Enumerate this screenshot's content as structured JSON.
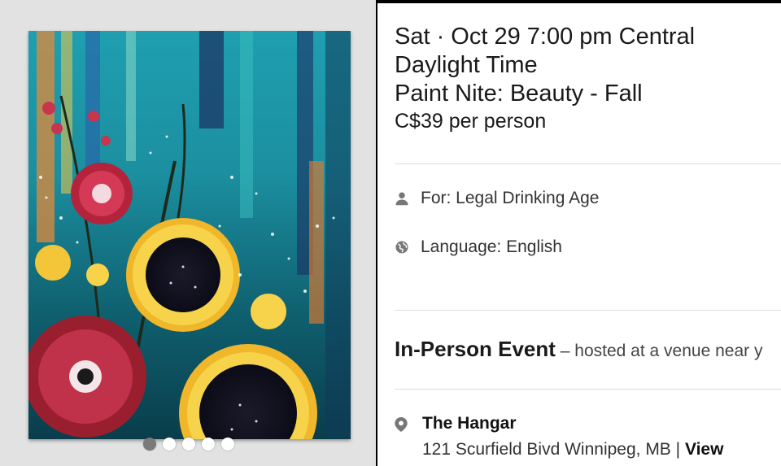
{
  "gallery": {
    "image_alt": "Acrylic painting of sunflowers and red dahlias on a teal and orange streaked background",
    "dots": 5,
    "active_dot": 0
  },
  "event": {
    "datetime": "Sat · Oct 29 7:00 pm Central Daylight Time",
    "title": "Paint Nite: Beauty - Fall",
    "price": "C$39 per person",
    "for_label": "For: Legal Drinking Age",
    "language_label": "Language: English",
    "type_strong": "In-Person Event",
    "type_note": " – hosted at a venue near y"
  },
  "venue": {
    "name": "The Hangar",
    "address": "121 Scurfield Bivd Winnipeg, MB",
    "separator": " | ",
    "view_label": "View"
  },
  "colors": {
    "background": "#e2e2e2",
    "frame": "#000000",
    "text": "#1a1a1a",
    "icon": "#777777"
  }
}
